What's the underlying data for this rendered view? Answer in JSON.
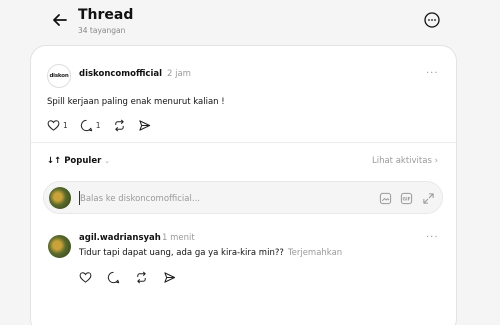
{
  "header": {
    "title": "Thread",
    "views": "34 tayangan",
    "back_icon": "arrow-left-icon",
    "more_icon": "more-circle-icon"
  },
  "post": {
    "avatar_text": "diskon",
    "username": "diskoncomofficial",
    "time": "2 jam",
    "menu": "···",
    "text": "Spill kerjaan paling enak menurut kalian !",
    "likes": "1",
    "comments": "1"
  },
  "sort": {
    "label": "↓↑ Populer",
    "chevron": "⌄",
    "activity": "Lihat aktivitas ›"
  },
  "reply": {
    "placeholder": "Balas ke diskoncomofficial...",
    "icons": [
      "image-icon",
      "gif-icon",
      "expand-icon"
    ]
  },
  "comment": {
    "username": "agil.wadriansyah",
    "time": "1 menit",
    "menu": "···",
    "text": "Tidur tapi dapat uang, ada ga ya kira-kira min??",
    "translate": "Terjemahkan"
  },
  "colors": {
    "background": "#f5f5f5",
    "card": "#ffffff",
    "muted": "#9a9a9a",
    "logo_accent": "#e8a317"
  }
}
